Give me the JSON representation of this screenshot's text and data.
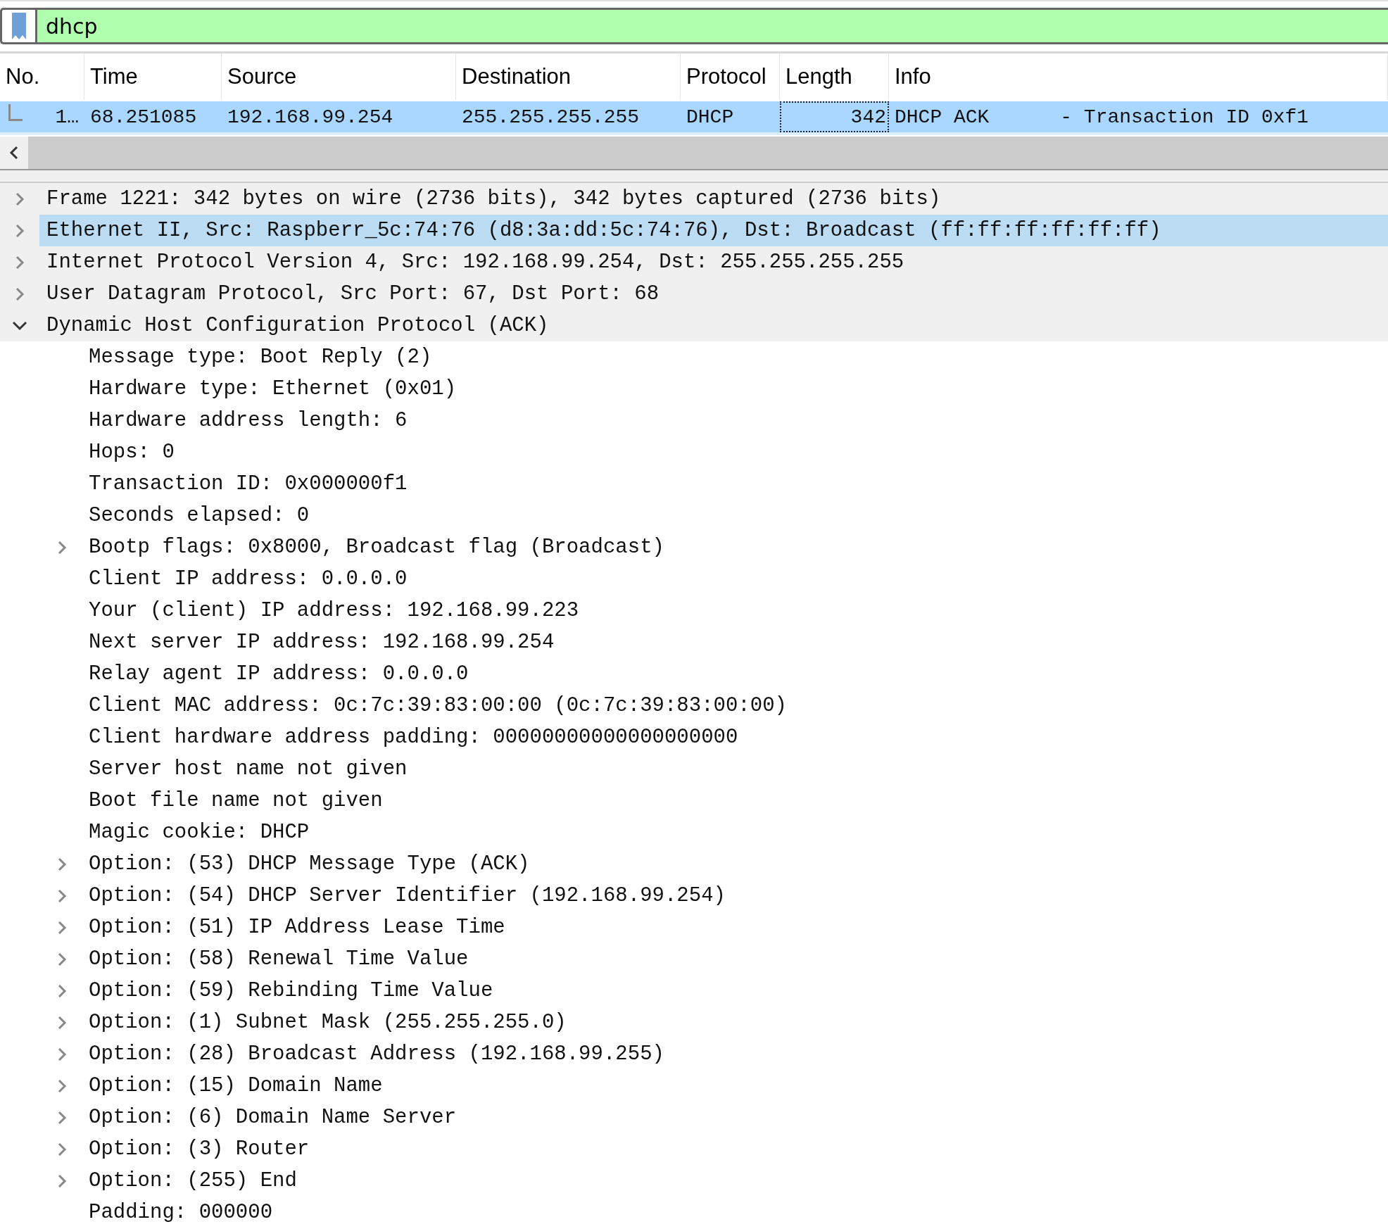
{
  "filter": {
    "value": "dhcp"
  },
  "packet_list": {
    "columns": [
      "No.",
      "Time",
      "Source",
      "Destination",
      "Protocol",
      "Length",
      "Info"
    ],
    "rows": [
      {
        "selected": true,
        "cells": [
          "1…",
          "68.251085",
          "192.168.99.254",
          "255.255.255.255",
          "DHCP",
          "342",
          "DHCP ACK      - Transaction ID 0xf1"
        ]
      }
    ]
  },
  "details": [
    {
      "text": "Frame 1221: 342 bytes on wire (2736 bits), 342 bytes captured (2736 bits)",
      "expanded": false,
      "selected": false
    },
    {
      "text": "Ethernet II, Src: Raspberr_5c:74:76 (d8:3a:dd:5c:74:76), Dst: Broadcast (ff:ff:ff:ff:ff:ff)",
      "expanded": false,
      "selected": true
    },
    {
      "text": "Internet Protocol Version 4, Src: 192.168.99.254, Dst: 255.255.255.255",
      "expanded": false,
      "selected": false
    },
    {
      "text": "User Datagram Protocol, Src Port: 67, Dst Port: 68",
      "expanded": false,
      "selected": false
    },
    {
      "text": "Dynamic Host Configuration Protocol (ACK)",
      "expanded": true,
      "selected": false,
      "children": [
        {
          "text": "Message type: Boot Reply (2)",
          "selected": false
        },
        {
          "text": "Hardware type: Ethernet (0x01)",
          "selected": false
        },
        {
          "text": "Hardware address length: 6",
          "selected": false
        },
        {
          "text": "Hops: 0",
          "selected": false
        },
        {
          "text": "Transaction ID: 0x000000f1",
          "selected": false
        },
        {
          "text": "Seconds elapsed: 0",
          "selected": false
        },
        {
          "text": "Bootp flags: 0x8000, Broadcast flag (Broadcast)",
          "expanded": false,
          "selected": false
        },
        {
          "text": "Client IP address: 0.0.0.0",
          "selected": false
        },
        {
          "text": "Your (client) IP address: 192.168.99.223",
          "selected": false
        },
        {
          "text": "Next server IP address: 192.168.99.254",
          "selected": false
        },
        {
          "text": "Relay agent IP address: 0.0.0.0",
          "selected": false
        },
        {
          "text": "Client MAC address: 0c:7c:39:83:00:00 (0c:7c:39:83:00:00)",
          "selected": false
        },
        {
          "text": "Client hardware address padding: 00000000000000000000",
          "selected": false
        },
        {
          "text": "Server host name not given",
          "selected": false
        },
        {
          "text": "Boot file name not given",
          "selected": false
        },
        {
          "text": "Magic cookie: DHCP",
          "selected": false
        },
        {
          "text": "Option: (53) DHCP Message Type (ACK)",
          "expanded": false,
          "selected": false
        },
        {
          "text": "Option: (54) DHCP Server Identifier (192.168.99.254)",
          "expanded": false,
          "selected": false
        },
        {
          "text": "Option: (51) IP Address Lease Time",
          "expanded": false,
          "selected": false
        },
        {
          "text": "Option: (58) Renewal Time Value",
          "expanded": false,
          "selected": false
        },
        {
          "text": "Option: (59) Rebinding Time Value",
          "expanded": false,
          "selected": false
        },
        {
          "text": "Option: (1) Subnet Mask (255.255.255.0)",
          "expanded": false,
          "selected": false
        },
        {
          "text": "Option: (28) Broadcast Address (192.168.99.255)",
          "expanded": false,
          "selected": false
        },
        {
          "text": "Option: (15) Domain Name",
          "expanded": false,
          "selected": false
        },
        {
          "text": "Option: (6) Domain Name Server",
          "expanded": false,
          "selected": false
        },
        {
          "text": "Option: (3) Router",
          "expanded": false,
          "selected": false
        },
        {
          "text": "Option: (255) End",
          "expanded": false,
          "selected": false
        },
        {
          "text": "Padding: 000000",
          "selected": false
        }
      ]
    }
  ]
}
